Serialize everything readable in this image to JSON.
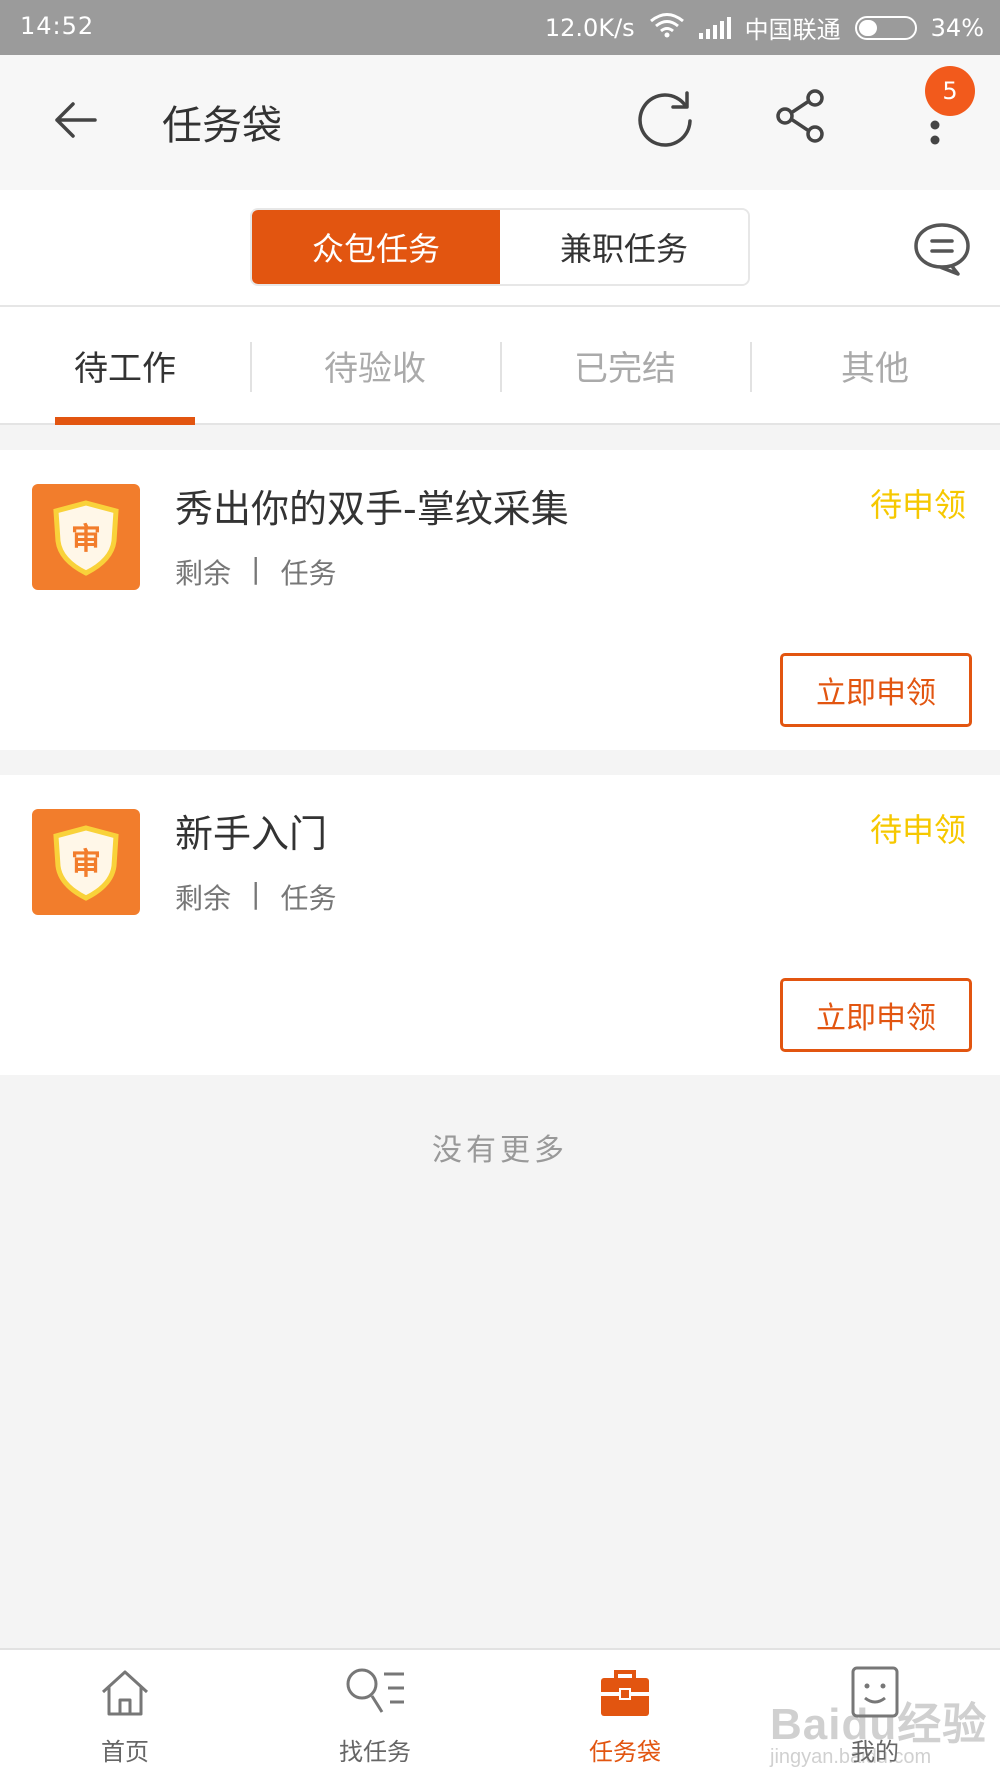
{
  "status_bar": {
    "time": "14:52",
    "speed": "12.0K/s",
    "carrier": "中国联通",
    "battery": "34%",
    "battery_level": 0.34
  },
  "app_bar": {
    "title": "任务袋",
    "badge_count": "5",
    "icons": [
      "back-arrow-icon",
      "refresh-icon",
      "share-icon",
      "more-vertical-icon"
    ]
  },
  "segment": {
    "items": [
      {
        "label": "众包任务",
        "active": true
      },
      {
        "label": "兼职任务",
        "active": false
      }
    ]
  },
  "tabs": [
    {
      "label": "待工作",
      "active": true
    },
    {
      "label": "待验收",
      "active": false
    },
    {
      "label": "已完结",
      "active": false
    },
    {
      "label": "其他",
      "active": false
    }
  ],
  "tasks": [
    {
      "icon_glyph": "审",
      "title": "秀出你的双手-掌纹采集",
      "remain_label": "剩余",
      "separator": "|",
      "unit_label": "任务",
      "status": "待申领",
      "action_label": "立即申领"
    },
    {
      "icon_glyph": "审",
      "title": "新手入门",
      "remain_label": "剩余",
      "separator": "|",
      "unit_label": "任务",
      "status": "待申领",
      "action_label": "立即申领"
    }
  ],
  "list_footer": "没有更多",
  "bottom_nav": [
    {
      "label": "首页",
      "icon": "home-icon",
      "active": false
    },
    {
      "label": "找任务",
      "icon": "search-list-icon",
      "active": false
    },
    {
      "label": "任务袋",
      "icon": "briefcase-icon",
      "active": true
    },
    {
      "label": "我的",
      "icon": "profile-face-icon",
      "active": false
    }
  ],
  "watermark": {
    "brand": "Baidu经验",
    "url": "jingyan.baidu.com"
  },
  "colors": {
    "accent": "#e25510",
    "status_pending": "#f6c800",
    "badge": "#f25a1c"
  }
}
